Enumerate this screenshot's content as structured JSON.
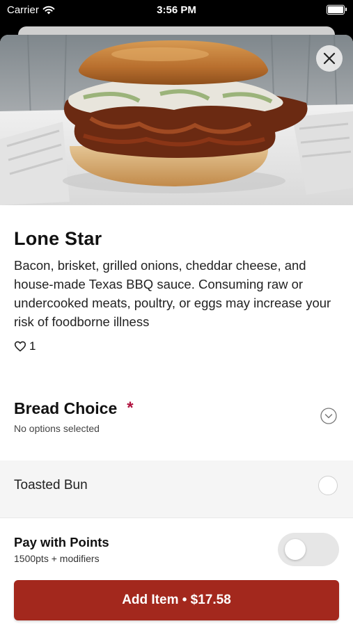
{
  "status_bar": {
    "carrier": "Carrier",
    "time": "3:56 PM"
  },
  "item": {
    "name": "Lone Star",
    "description": "Bacon, brisket, grilled onions, cheddar cheese, and house-made Texas BBQ sauce. Consuming raw or undercooked meats, poultry, or eggs may increase your risk of foodborne illness",
    "likes": "1"
  },
  "bread_choice": {
    "title": "Bread Choice",
    "required_mark": "*",
    "status": "No options selected",
    "options": [
      {
        "label": "Toasted Bun",
        "selected": false
      }
    ]
  },
  "points": {
    "title": "Pay with Points",
    "subtitle": "1500pts + modifiers",
    "enabled": false
  },
  "add_button": {
    "label": "Add Item • $17.58"
  },
  "colors": {
    "accent": "#a3281d",
    "required": "#b0123e"
  },
  "icons": [
    "wifi-icon",
    "battery-icon",
    "close-icon",
    "heart-icon",
    "chevron-down-icon"
  ]
}
